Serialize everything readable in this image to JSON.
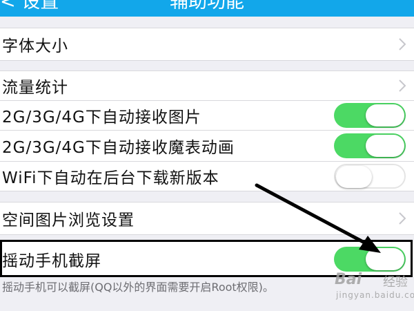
{
  "navbar": {
    "back_label": "< 设置",
    "title": "辅助功能"
  },
  "rows": {
    "font_size": {
      "label": "字体大小"
    },
    "data_usage": {
      "label": "流量统计"
    },
    "auto_receive_images": {
      "label": "2G/3G/4G下自动接收图片",
      "on": true
    },
    "auto_receive_magic": {
      "label": "2G/3G/4G下自动接收魔表动画",
      "on": true
    },
    "wifi_auto_download": {
      "label": "WiFi下自动在后台下载新版本",
      "on": false
    },
    "qzone_image_settings": {
      "label": "空间图片浏览设置"
    },
    "shake_screenshot": {
      "label": "摇动手机截屏",
      "on": true
    }
  },
  "footer_note": "摇动手机可以截屏(QQ以外的界面需要开启Root权限)。",
  "watermark": {
    "brand": "Bai",
    "sub": "经验",
    "url": "jingyan.baidu.com"
  },
  "colors": {
    "nav_bar": "#12a7ea",
    "toggle_on": "#4cd964",
    "page_bg": "#efeff4",
    "annotation": "#000000"
  },
  "icons": {
    "chevron": "chevron-right-icon",
    "annotation_arrow": "arrow-annotation-icon"
  }
}
